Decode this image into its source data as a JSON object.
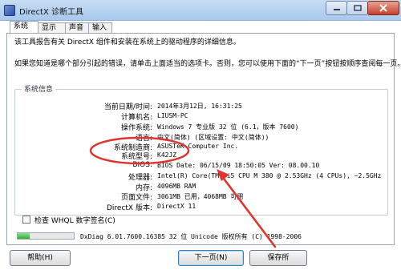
{
  "window": {
    "title": "DirectX 诊断工具"
  },
  "tabs": [
    {
      "label": "系统"
    },
    {
      "label": "显示"
    },
    {
      "label": "声音"
    },
    {
      "label": "输入"
    }
  ],
  "intro": {
    "line1": "该工具报告有关 DirectX 组件和安装在系统上的驱动程序的详细信息。",
    "line2": "如果您知道是哪个部分引起的错误，请单击上面适当的选项卡。否则，您可以使用下面的“下一页”按钮按顺序查阅每一页。"
  },
  "system_info": {
    "group_title": "系统信息",
    "rows": [
      {
        "label": "当前日期/时间:",
        "value": "2014年3月12日, 16:31:25"
      },
      {
        "label": "计算机名:",
        "value": "LIUSM-PC"
      },
      {
        "label": "操作系统:",
        "value": "Windows 7 专业版 32 位 (6.1，版本 7600)"
      },
      {
        "label": "语言:",
        "value": "中文(简体) (区域设置: 中文(简体))"
      },
      {
        "label": "系统制造商:",
        "value": "ASUSTeK Computer Inc."
      },
      {
        "label": "系统型号:",
        "value": "K42JZ"
      },
      {
        "label": "BIOS:",
        "value": "BIOS Date: 06/15/09 18:50:05 Ver: 08.00.10"
      },
      {
        "label": "处理器:",
        "value": "Intel(R) Core(TM) i5 CPU      M 380 @ 2.53GHz (4 CPUs), ~2.5GHz"
      },
      {
        "label": "内存:",
        "value": "4096MB RAM"
      },
      {
        "label": "页面文件:",
        "value": "3061MB 已用，4068MB 可用"
      },
      {
        "label": "DirectX 版本:",
        "value": "DirectX 11"
      }
    ]
  },
  "whql": {
    "label": "检查 WHQL 数字签名(C)",
    "checked": false
  },
  "status": {
    "progress": 0.22,
    "version_text": "DxDiag 6.01.7600.16385 32 位 Unicode 版权所有 (C) 1998-2006"
  },
  "buttons": {
    "help": "帮助(H)",
    "next": "下一页(N)",
    "save": "保存所"
  },
  "colors": {
    "annotation": "#e0332b",
    "titlebar": "#b8d3ef",
    "progress_fill": "#2fae2f"
  }
}
